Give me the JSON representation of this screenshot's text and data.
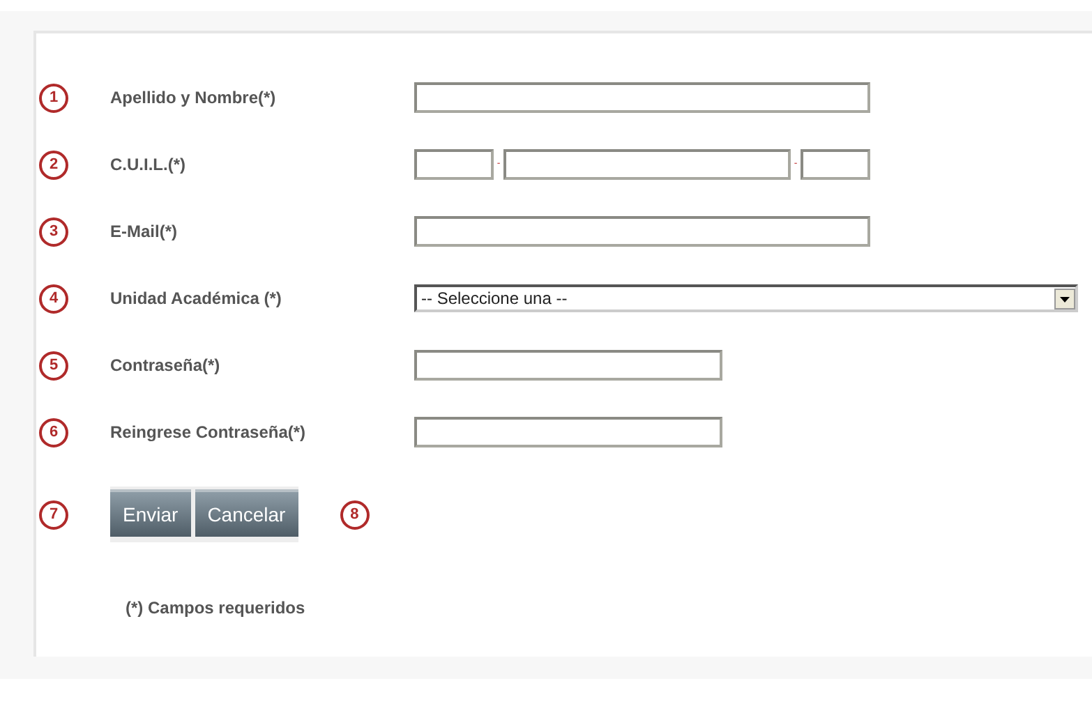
{
  "form": {
    "fields": [
      {
        "number": "1",
        "label": "Apellido y Nombre(*)",
        "kind": "text"
      },
      {
        "number": "2",
        "label": "C.U.I.L.(*)",
        "kind": "cuil",
        "separators": [
          "-",
          "-"
        ]
      },
      {
        "number": "3",
        "label": "E-Mail(*)",
        "kind": "text"
      },
      {
        "number": "4",
        "label": "Unidad Académica (*)",
        "kind": "select",
        "value": "-- Seleccione una --"
      },
      {
        "number": "5",
        "label": "Contraseña(*)",
        "kind": "password"
      },
      {
        "number": "6",
        "label": "Reingrese Contraseña(*)",
        "kind": "password"
      }
    ],
    "actions": {
      "number": "7",
      "buttons": [
        "Enviar",
        "Cancelar"
      ],
      "after_number": "8"
    },
    "footnote": "(*) Campos requeridos"
  }
}
